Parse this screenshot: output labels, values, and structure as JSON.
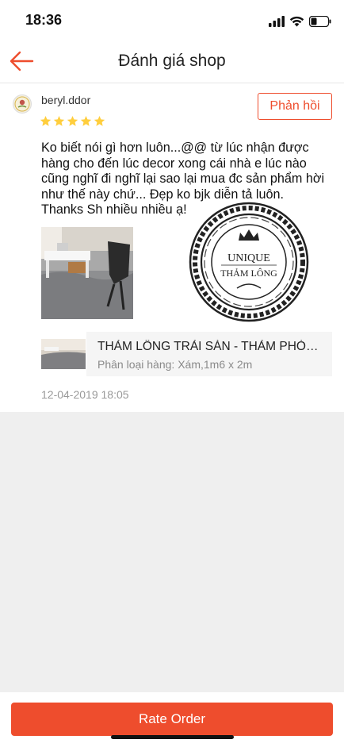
{
  "status_bar": {
    "time": "18:36"
  },
  "header": {
    "title": "Đánh giá shop",
    "back_icon": "back-arrow-icon"
  },
  "review": {
    "username": "beryl.ddor",
    "rating": 5,
    "rating_max": 5,
    "reply_label": "Phản hồi",
    "comment": "Ko biết nói gì hơn luôn...@@ từ lúc nhận được\nhàng cho đến lúc decor xong cái nhà e lúc nào\ncũng nghĩ đi nghĩ lại sao lại mua đc sản phẩm hời\nnhư thế này chứ... Đẹp ko bjk diễn tả luôn.\nThanks Sh nhiều nhiều ạ!",
    "watermark": {
      "line1": "UNIQUE",
      "line2": "THẢM LÔNG"
    },
    "product": {
      "name": "THẢM LÔNG TRẢI SÀN - THẢM PHÒNG KHÁCH",
      "variant": "Phân loại hàng: Xám,1m6 x 2m"
    },
    "date": "12-04-2019 18:05"
  },
  "footer": {
    "rate_label": "Rate Order"
  },
  "colors": {
    "accent": "#ee4d2d",
    "star": "#ffce3d"
  }
}
